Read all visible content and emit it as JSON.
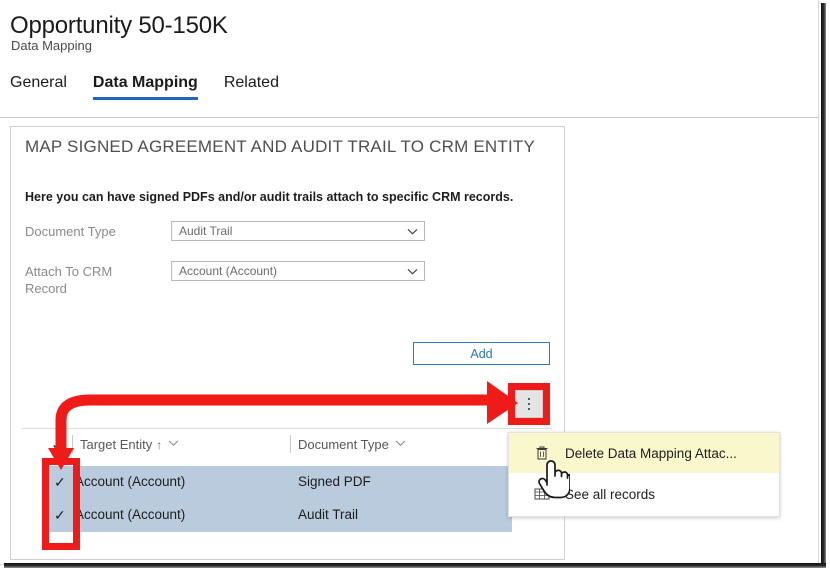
{
  "header": {
    "title": "Opportunity 50-150K",
    "subtitle": "Data Mapping",
    "tabs": [
      {
        "label": "General",
        "active": false
      },
      {
        "label": "Data Mapping",
        "active": true
      },
      {
        "label": "Related",
        "active": false
      }
    ],
    "active_tab_underline_color": "#2266bb"
  },
  "card": {
    "title": "MAP SIGNED AGREEMENT AND AUDIT TRAIL TO CRM ENTITY",
    "description": "Here you can have signed PDFs and/or audit trails attach to specific CRM records.",
    "fields": [
      {
        "label": "Document Type",
        "value": "Audit Trail",
        "icon": "chevron-down-icon"
      },
      {
        "label": "Attach To CRM Record",
        "value": "Account (Account)",
        "icon": "chevron-down-icon"
      }
    ],
    "add_button": {
      "label": "Add",
      "text_color": "#2a73b2",
      "border_color": "#2e7fb0"
    },
    "overflow_button": {
      "icon": "more-vertical-icon",
      "background": "#e4e4e4"
    }
  },
  "grid": {
    "select_all_check": "✓",
    "columns": [
      {
        "label": "Target Entity",
        "sort": "↑",
        "filter_icon": "chevron-down-icon"
      },
      {
        "label": "Document Type",
        "sort": "",
        "filter_icon": "chevron-down-icon"
      }
    ],
    "rows": [
      {
        "selected": true,
        "check": "✓",
        "target_entity": "Account (Account)",
        "document_type": "Signed PDF"
      },
      {
        "selected": true,
        "check": "✓",
        "target_entity": "Account (Account)",
        "document_type": "Audit Trail"
      }
    ],
    "selected_row_color": "#b9cbdd"
  },
  "context_menu": {
    "items": [
      {
        "label": "Delete Data Mapping Attac...",
        "icon": "trash-icon",
        "highlighted": true,
        "highlight_color": "#fbf7cd"
      },
      {
        "label": "See all records",
        "icon": "grid-table-icon",
        "highlighted": false,
        "highlight_color": "#ffffff"
      }
    ]
  },
  "annotations": {
    "highlight_color": "#ee1b18",
    "arrow": "curved-arrow-from-checkbox-column-to-overflow-button",
    "boxes": [
      "overflow-button-highlight",
      "row-checkbox-column-highlight"
    ],
    "cursor": "hand-pointer-cursor"
  }
}
